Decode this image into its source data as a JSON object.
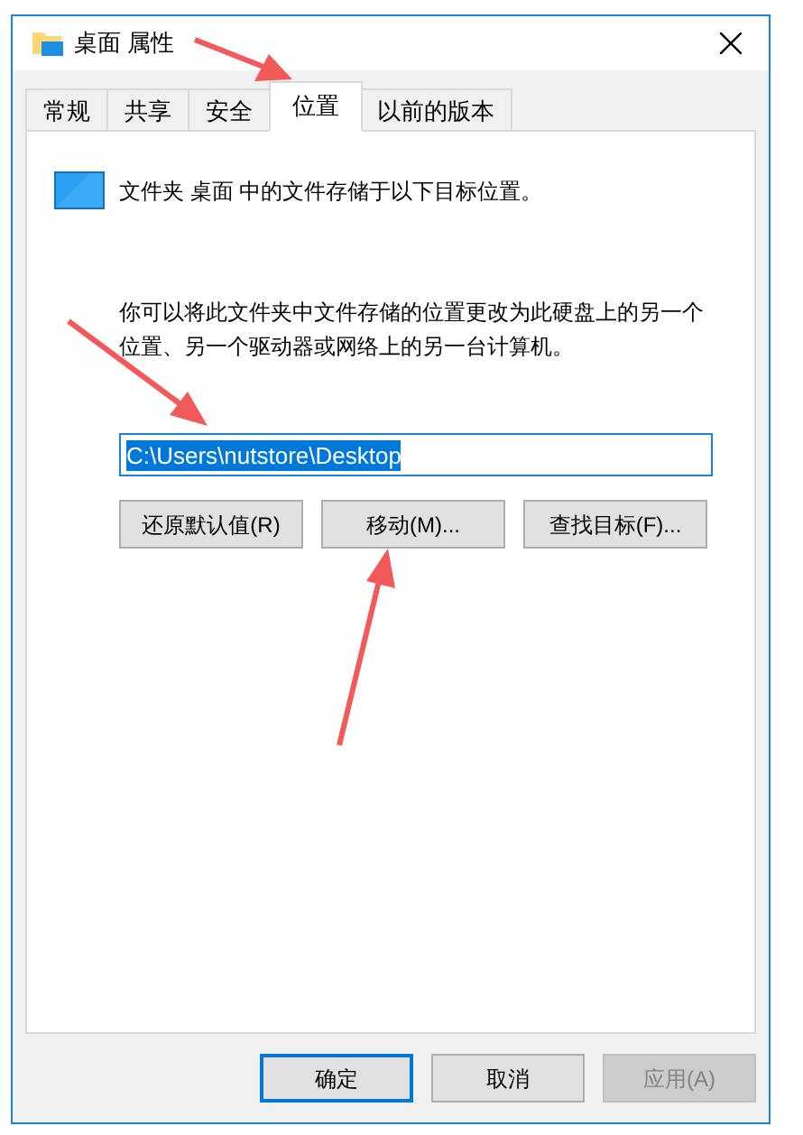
{
  "window": {
    "title": "桌面 属性"
  },
  "tabs": [
    {
      "label": "常规",
      "selected": false
    },
    {
      "label": "共享",
      "selected": false
    },
    {
      "label": "安全",
      "selected": false
    },
    {
      "label": "位置",
      "selected": true
    },
    {
      "label": "以前的版本",
      "selected": false
    }
  ],
  "location": {
    "description": "文件夹 桌面 中的文件存储于以下目标位置。",
    "explanation": "你可以将此文件夹中文件存储的位置更改为此硬盘上的另一个位置、另一个驱动器或网络上的另一台计算机。",
    "path": "C:\\Users\\nutstore\\Desktop",
    "path_selected": true,
    "buttons": [
      "还原默认值(R)",
      "移动(M)...",
      "查找目标(F)..."
    ]
  },
  "dialog_buttons": [
    {
      "label": "确定",
      "default": true,
      "disabled": false
    },
    {
      "label": "取消",
      "default": false,
      "disabled": false
    },
    {
      "label": "应用(A)",
      "default": false,
      "disabled": true
    }
  ]
}
